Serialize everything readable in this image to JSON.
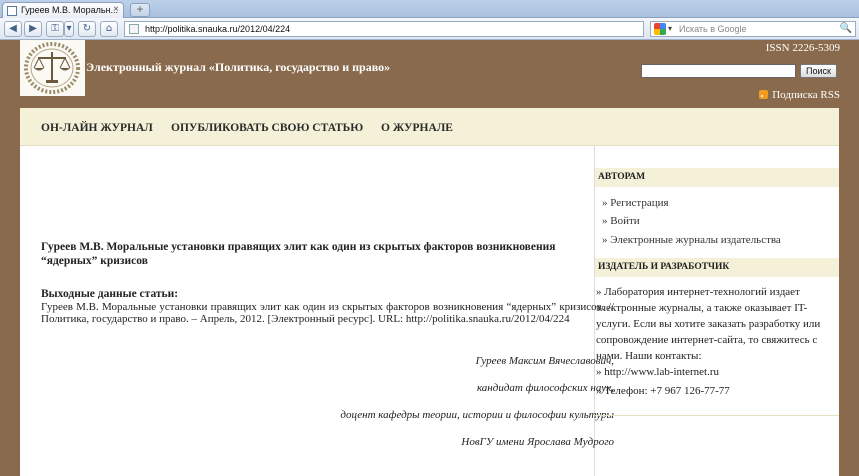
{
  "browser": {
    "tab_title": "Гуреев М.В. Моральн...",
    "tab_close": "×",
    "new_tab": "+",
    "url": "http://politika.snauka.ru/2012/04/224",
    "search_placeholder": "Искать в Google",
    "nav": {
      "back": "◀",
      "forward": "▶",
      "key": "⚿",
      "dropdown": "▾",
      "reload": "↻",
      "home": "⌂"
    },
    "search_go": "🔍",
    "engine_drop": "▾"
  },
  "site": {
    "title": "Электронный журнал «Политика, государство и право»",
    "issn": "ISSN 2226-5309",
    "search_button": "Поиск",
    "rss_label": "Подписка RSS"
  },
  "main_nav": [
    "ОН-ЛАЙН ЖУРНАЛ",
    "ОПУБЛИКОВАТЬ СВОЮ СТАТЬЮ",
    "О ЖУРНАЛЕ"
  ],
  "article": {
    "title": "Гуреев М.В. Моральные установки правящих элит как один из скрытых факторов возникновения “ядерных” кризисов",
    "meta_heading": "Выходные данные статьи:",
    "meta_text": "Гуреев М.В. Моральные установки правящих элит как один из скрытых факторов возникновения “ядерных” кризисов. // Политика, государство и право. – Апрель, 2012. [Электронный ресурс]. URL: http://politika.snauka.ru/2012/04/224",
    "author_lines": [
      "Гуреев Максим Вячеславович,",
      "кандидат философских наук,",
      "доцент кафедры теории, истории и философии культуры",
      "НовГУ имени Ярослава Мудрого"
    ]
  },
  "sidebar": {
    "authors_heading": "АВТОРАМ",
    "authors_links": [
      "» Регистрация",
      "» Войти",
      "» Электронные журналы издательства"
    ],
    "publisher_heading": "ИЗДАТЕЛЬ И РАЗРАБОТЧИК",
    "publisher_text": "» Лаборатория интернет-технологий издает электронные журналы, а также оказывает IT-услуги. Если вы хотите заказать разработку или сопровождение интернет-сайта, то свяжитесь с нами. Наши контакты:",
    "publisher_site": "» http://www.lab-internet.ru",
    "publisher_phone": "» Телефон: +7 967 126-77-77"
  },
  "colors": {
    "page_background": "#8a6a4c",
    "nav_background": "#f4f1d8",
    "header_text": "#ffffff"
  }
}
